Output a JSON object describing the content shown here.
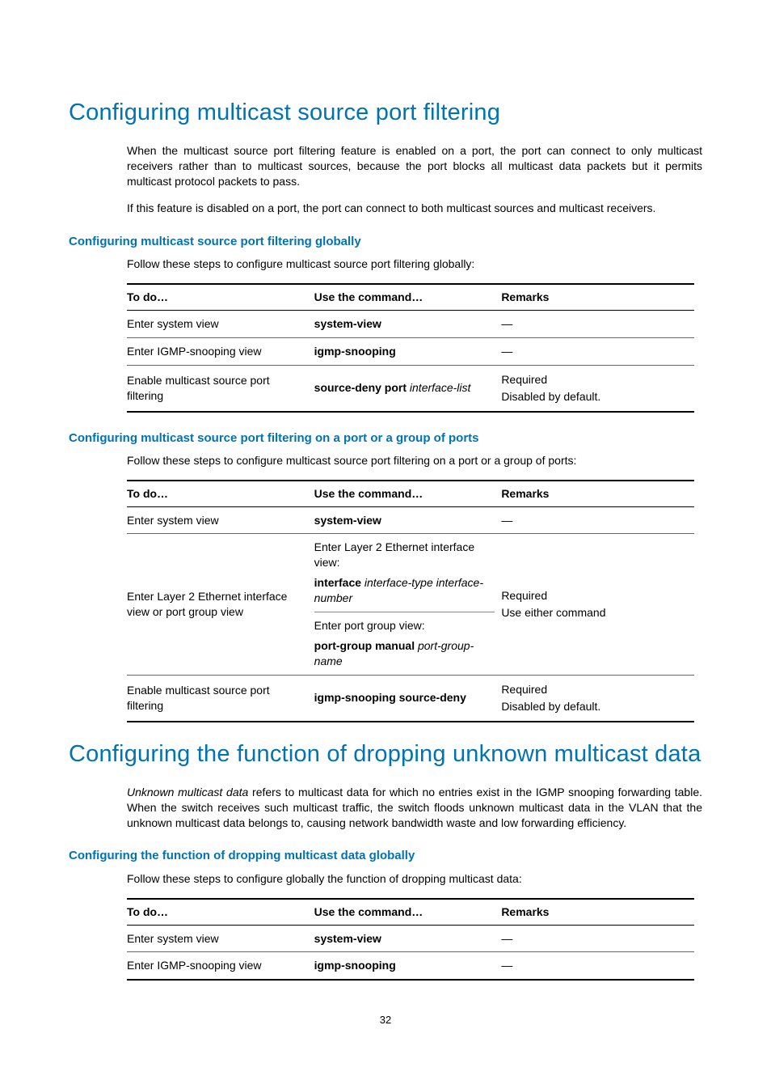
{
  "section1": {
    "title": "Configuring multicast source port filtering",
    "p1": "When the multicast source port filtering feature is enabled on a port, the port can connect to only multicast receivers rather than to multicast sources, because the port blocks all multicast data packets but it permits multicast protocol packets to pass.",
    "p2": "If this feature is disabled on a port, the port can connect to both multicast sources and multicast receivers.",
    "sub1": {
      "heading": "Configuring multicast source port filtering globally",
      "intro": "Follow these steps to configure multicast source port filtering globally:",
      "headers": {
        "c1": "To do…",
        "c2": "Use the command…",
        "c3": "Remarks"
      },
      "rows": [
        {
          "todo": "Enter system view",
          "cmd": "system-view",
          "cmd_arg": "",
          "remarks": "—"
        },
        {
          "todo": "Enter IGMP-snooping view",
          "cmd": "igmp-snooping",
          "cmd_arg": "",
          "remarks": "—"
        },
        {
          "todo": "Enable multicast source port filtering",
          "cmd": "source-deny port",
          "cmd_arg": "interface-list",
          "remarks_l1": "Required",
          "remarks_l2": "Disabled by default."
        }
      ]
    },
    "sub2": {
      "heading": "Configuring multicast source port filtering on a port or a group of ports",
      "intro": "Follow these steps to configure multicast source port filtering on a port or a group of ports:",
      "headers": {
        "c1": "To do…",
        "c2": "Use the command…",
        "c3": "Remarks"
      },
      "rows": {
        "r1": {
          "todo": "Enter system view",
          "cmd": "system-view",
          "remarks": "—"
        },
        "r2": {
          "todo": "Enter Layer 2 Ethernet interface view or port group view",
          "block1_label": "Enter Layer 2 Ethernet interface view:",
          "block1_cmd": "interface",
          "block1_arg": "interface-type interface-number",
          "block2_label": "Enter port group view:",
          "block2_cmd": "port-group manual",
          "block2_arg": "port-group-name",
          "remarks_l1": "Required",
          "remarks_l2": "Use either command"
        },
        "r3": {
          "todo": "Enable multicast source port filtering",
          "cmd": "igmp-snooping source-deny",
          "remarks_l1": "Required",
          "remarks_l2": "Disabled by default."
        }
      }
    }
  },
  "section2": {
    "title": "Configuring the function of dropping unknown multicast data",
    "p1_lead": "Unknown multicast data",
    "p1_rest": " refers to multicast data for which no entries exist in the IGMP snooping forwarding table. When the switch receives such multicast traffic, the switch floods unknown multicast data in the VLAN that the unknown multicast data belongs to, causing network bandwidth waste and low forwarding efficiency.",
    "sub1": {
      "heading": "Configuring the function of dropping multicast data globally",
      "intro": "Follow these steps to configure globally the function of dropping multicast data:",
      "headers": {
        "c1": "To do…",
        "c2": "Use the command…",
        "c3": "Remarks"
      },
      "rows": [
        {
          "todo": "Enter system view",
          "cmd": "system-view",
          "remarks": "—"
        },
        {
          "todo": "Enter IGMP-snooping view",
          "cmd": "igmp-snooping",
          "remarks": "—"
        }
      ]
    }
  },
  "page": "32"
}
